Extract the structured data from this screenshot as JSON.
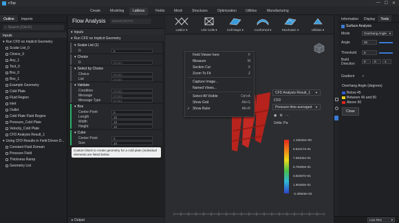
{
  "window": {
    "title": "nTop",
    "minimize": "—",
    "maximize": "☐",
    "close": "✕"
  },
  "menu": {
    "items": [
      "Create",
      "Modeling",
      "Lattices",
      "Fields",
      "Mesh",
      "Structures",
      "Optimization",
      "Utilities",
      "Manufacturing"
    ],
    "active": "Lattices"
  },
  "left": {
    "tabs": [
      "Outline",
      "Imports"
    ],
    "search_placeholder": "Search (Ctrl+F)",
    "inputs_header": "Inputs",
    "groups": [
      {
        "title": "Run CFD on Implicit Geometry",
        "items": [
          "Scalar List_0",
          "Choice_0",
          "Any_1",
          "Text_0",
          "Box_0",
          "Box_1",
          "Example Geometry",
          "Cold Plate",
          "Fluid Region",
          "Inlet",
          "Outlet",
          "Cold Plate Fluid Region",
          "Pressure_Cold Plate",
          "Velocity_Cold Plate",
          "CFD Analysis Result_1"
        ]
      },
      {
        "title": "Using CFD Results in Field Driven D...",
        "items": [
          "Constant Fluid Domain",
          "Pressure Field",
          "Thickness Ramp",
          "Geometry List"
        ]
      }
    ]
  },
  "flow": {
    "title": "Flow Analysis",
    "search_placeholder": "Search (Ctrl+F)",
    "inputs_label": "Inputs",
    "notebook_title": "Run CFD on Implicit Geometry",
    "blocks": [
      {
        "name": "Scalar List (1)",
        "rows": [
          {
            "label": "0:",
            "value": "0"
          }
        ]
      },
      {
        "name": "Choice",
        "rows": [
          {
            "label": "0:",
            "value": "Empty"
          }
        ]
      },
      {
        "name": "Select by Choice",
        "rows": [
          {
            "label": "Choice",
            "value": "Empty"
          },
          {
            "label": "List",
            "value": "Empty"
          }
        ]
      },
      {
        "name": "Validate",
        "rows": [
          {
            "label": "Condition",
            "value": "Empty"
          },
          {
            "label": "Message",
            "value": "Empty"
          },
          {
            "label": "Message Type",
            "value": "Empty"
          }
        ]
      },
      {
        "name": "Box",
        "rows": [
          {
            "label": "Center Point",
            "value": "0"
          },
          {
            "label": "Length",
            "value": "10"
          },
          {
            "label": "Width",
            "value": "10"
          },
          {
            "label": "Height",
            "value": "10"
          }
        ]
      },
      {
        "name": "Cube",
        "rows": [
          {
            "label": "Center Point",
            "value": "0"
          },
          {
            "label": "Size",
            "value": "10"
          }
        ]
      }
    ],
    "tooltip": "Custom block to create geometry for a cold plate (individual elements are listed below",
    "output_label": "Output"
  },
  "ribbon": {
    "items": [
      {
        "label": "Lattice ▾",
        "icon": "lattice-icon"
      },
      {
        "label": "Unit Cells ▾",
        "icon": "unit-cells-icon"
      },
      {
        "label": "Cell Maps ▾",
        "icon": "cell-maps-icon"
      },
      {
        "label": "Conformal ▾",
        "icon": "conformal-icon"
      },
      {
        "label": "Stochastic ▾",
        "icon": "stochastic-icon"
      },
      {
        "label": "Utilities ▾",
        "icon": "utilities-icon"
      }
    ]
  },
  "context_menu": {
    "items": [
      {
        "label": "Field Viewer here",
        "shortcut": "F",
        "checked": false
      },
      {
        "label": "Measure",
        "shortcut": "M",
        "checked": false
      },
      {
        "label": "Section Cut",
        "shortcut": "X",
        "checked": false
      },
      {
        "label": "Zoom To Fit",
        "shortcut": "Z",
        "checked": false
      },
      {
        "label": "Capture Image...",
        "shortcut": "",
        "checked": false
      },
      {
        "label": "Named Views...",
        "shortcut": "",
        "checked": false
      },
      {
        "label": "Select All Visible",
        "shortcut": "Ctrl+A",
        "checked": false
      },
      {
        "label": "Show Grid",
        "shortcut": "Alt+G",
        "checked": false
      },
      {
        "label": "Show Ruler",
        "shortcut": "Alt+R",
        "checked": true
      }
    ]
  },
  "results": {
    "selector": "CFD Analysis Result_1",
    "sub_label": "CFD",
    "quantity": "Pressure time-averaged",
    "units": "Units: Pa",
    "legend_values": [
      "1.15540e+00",
      "8.62417e-01",
      "7.69434e-01",
      "5.76450e-01",
      "3.83467e-01",
      "1.90483e-01",
      "-2.49946e-03"
    ],
    "colormap": [
      "#e3261f",
      "#f07a16",
      "#eadc19",
      "#49c24a",
      "#2fb7d4",
      "#2f43c9"
    ]
  },
  "right": {
    "tabs": [
      "Information",
      "Display",
      "Tools"
    ],
    "active_tab": "Tools",
    "section_title": "Surface Analysis",
    "mode_label": "Mode",
    "mode_value": "Overhang Angle",
    "angle_label": "Angle",
    "angle_value": "45",
    "threshold_label": "Threshold",
    "threshold_value": "5",
    "build_dir_label": "Build Direction",
    "build_dir_values": [
      "0",
      "0",
      "1"
    ],
    "gradient_label": "Gradient",
    "legend_title": "Overhang Angle (degrees)",
    "legend": [
      {
        "label": "Below 45",
        "color": "#2f5bd4"
      },
      {
        "label": "Between 45 and 50",
        "color": "#e8d21a"
      },
      {
        "label": "Above 50",
        "color": "#d9261f"
      }
    ],
    "close_label": "Close"
  },
  "status": {
    "quality": "Low Res"
  },
  "geometry_text": "l00"
}
